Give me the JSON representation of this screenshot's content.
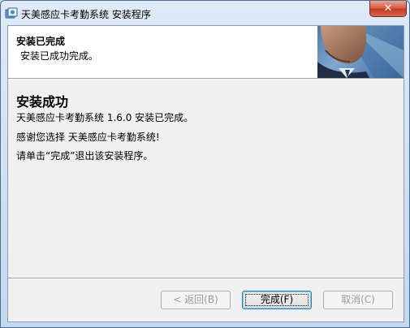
{
  "window": {
    "title": "天美感应卡考勤系统 安装程序",
    "close_symbol": "✕"
  },
  "header": {
    "title": "安装已完成",
    "subtitle": "安装已成功完成。"
  },
  "body": {
    "heading": "安装成功",
    "line1": "天美感应卡考勤系统 1.6.0 安装已完成。",
    "line2": "感谢您选择 天美感应卡考勤系统!",
    "line3": "请单击“完成”退出该安装程序。"
  },
  "buttons": {
    "back": "< 返回(B)",
    "finish": "完成(F)",
    "cancel": "取消(C)"
  },
  "icons": {
    "app": "installer-icon",
    "header_image": "businessman-photo",
    "close": "close-icon"
  },
  "colors": {
    "title_bar": "#c9d9ec",
    "close_button": "#c43b1f",
    "header_bg": "#ffffff",
    "client_bg": "#f0f0f0"
  }
}
